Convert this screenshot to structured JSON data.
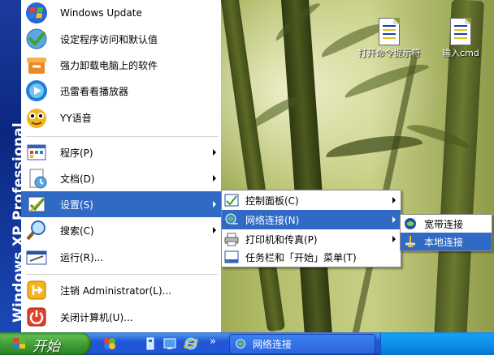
{
  "desktop": {
    "icons": [
      {
        "label": "打开命令提示符",
        "icon": "text-document-icon"
      },
      {
        "label": "输入cmd",
        "icon": "text-document-icon"
      }
    ]
  },
  "start_menu": {
    "side_banner": "Windows XP Professional",
    "pinned": [
      {
        "label": "Windows Update",
        "icon": "windows-update-icon"
      },
      {
        "label": "设定程序访问和默认值",
        "icon": "program-access-icon"
      },
      {
        "label": "强力卸载电脑上的软件",
        "icon": "uninstall-icon"
      },
      {
        "label": "迅雷看看播放器",
        "icon": "xunlei-player-icon"
      },
      {
        "label": "YY语音",
        "icon": "yy-voice-icon"
      }
    ],
    "main": [
      {
        "label": "程序(P)",
        "icon": "programs-icon"
      },
      {
        "label": "文档(D)",
        "icon": "documents-icon"
      },
      {
        "label": "设置(S)",
        "icon": "settings-icon"
      },
      {
        "label": "搜索(C)",
        "icon": "search-icon"
      },
      {
        "label": "运行(R)...",
        "icon": "run-icon"
      }
    ],
    "bottom": [
      {
        "label": "注销 Administrator(L)...",
        "icon": "logoff-icon"
      },
      {
        "label": "关闭计算机(U)...",
        "icon": "shutdown-icon"
      }
    ]
  },
  "settings_submenu": [
    {
      "label": "控制面板(C)",
      "icon": "control-panel-icon"
    },
    {
      "label": "网络连接(N)",
      "icon": "network-connections-icon"
    },
    {
      "label": "打印机和传真(P)",
      "icon": "printer-icon"
    },
    {
      "label": "任务栏和「开始」菜单(T)",
      "icon": "taskbar-icon"
    }
  ],
  "network_submenu": [
    {
      "label": "宽带连接",
      "icon": "broadband-icon"
    },
    {
      "label": "本地连接",
      "icon": "local-connection-icon"
    }
  ],
  "taskbar": {
    "start_label": "开始",
    "overflow": "»",
    "window_button": "网络连接"
  },
  "colors": {
    "highlight": "#316ac5",
    "side_band": "#0a2780",
    "taskbar": "#2157d7",
    "start_button": "#3a9a31"
  }
}
